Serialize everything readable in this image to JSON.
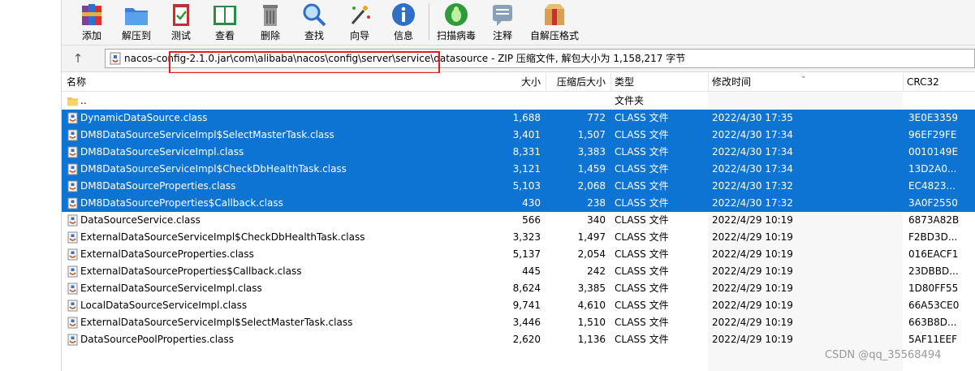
{
  "toolbar": {
    "buttons": [
      {
        "label": "添加",
        "icon": "add-archive-icon"
      },
      {
        "label": "解压到",
        "icon": "extract-to-folder-icon"
      },
      {
        "label": "测试",
        "icon": "test-clipboard-icon"
      },
      {
        "label": "查看",
        "icon": "view-book-icon"
      },
      {
        "label": "删除",
        "icon": "delete-trash-icon"
      },
      {
        "label": "查找",
        "icon": "find-magnifier-icon"
      },
      {
        "label": "向导",
        "icon": "wizard-wand-icon"
      },
      {
        "label": "信息",
        "icon": "info-icon"
      },
      {
        "label": "扫描病毒",
        "icon": "scan-virus-bug-icon"
      },
      {
        "label": "注释",
        "icon": "comment-icon"
      },
      {
        "label": "自解压格式",
        "icon": "sfx-box-icon"
      }
    ]
  },
  "address": {
    "path_prefix": "nacos-config-2.1.0.jar\\",
    "path_highlight": "com\\alibaba\\nacos\\config\\server\\service\\datasource",
    "path_suffix": " - ZIP 压缩文件, 解包大小为 1,158,217 字节"
  },
  "columns": {
    "name": "名称",
    "size": "大小",
    "packed": "压缩后大小",
    "type": "类型",
    "modified": "修改时间",
    "crc": "CRC32"
  },
  "rows": [
    {
      "name": "..",
      "size": "",
      "packed": "",
      "type": "文件夹",
      "modified": "",
      "crc": "",
      "selected": false,
      "kind": "folder"
    },
    {
      "name": "DynamicDataSource.class",
      "size": "1,688",
      "packed": "772",
      "type": "CLASS 文件",
      "modified": "2022/4/30 17:35",
      "crc": "3E0E3359",
      "selected": true,
      "kind": "file"
    },
    {
      "name": "DM8DataSourceServiceImpl$SelectMasterTask.class",
      "size": "3,401",
      "packed": "1,507",
      "type": "CLASS 文件",
      "modified": "2022/4/30 17:34",
      "crc": "96EF29FE",
      "selected": true,
      "kind": "file"
    },
    {
      "name": "DM8DataSourceServiceImpl.class",
      "size": "8,331",
      "packed": "3,383",
      "type": "CLASS 文件",
      "modified": "2022/4/30 17:34",
      "crc": "0010149E",
      "selected": true,
      "kind": "file"
    },
    {
      "name": "DM8DataSourceServiceImpl$CheckDbHealthTask.class",
      "size": "3,121",
      "packed": "1,459",
      "type": "CLASS 文件",
      "modified": "2022/4/30 17:34",
      "crc": "13D2A0...",
      "selected": true,
      "kind": "file"
    },
    {
      "name": "DM8DataSourceProperties.class",
      "size": "5,103",
      "packed": "2,068",
      "type": "CLASS 文件",
      "modified": "2022/4/30 17:32",
      "crc": "EC4823...",
      "selected": true,
      "kind": "file"
    },
    {
      "name": "DM8DataSourceProperties$Callback.class",
      "size": "430",
      "packed": "238",
      "type": "CLASS 文件",
      "modified": "2022/4/30 17:32",
      "crc": "3A0F2550",
      "selected": true,
      "kind": "file"
    },
    {
      "name": "DataSourceService.class",
      "size": "566",
      "packed": "340",
      "type": "CLASS 文件",
      "modified": "2022/4/29 10:19",
      "crc": "6873A82B",
      "selected": false,
      "kind": "file"
    },
    {
      "name": "ExternalDataSourceServiceImpl$CheckDbHealthTask.class",
      "size": "3,323",
      "packed": "1,497",
      "type": "CLASS 文件",
      "modified": "2022/4/29 10:19",
      "crc": "F2BD3D...",
      "selected": false,
      "kind": "file"
    },
    {
      "name": "ExternalDataSourceProperties.class",
      "size": "5,137",
      "packed": "2,054",
      "type": "CLASS 文件",
      "modified": "2022/4/29 10:19",
      "crc": "016EACF1",
      "selected": false,
      "kind": "file"
    },
    {
      "name": "ExternalDataSourceProperties$Callback.class",
      "size": "445",
      "packed": "242",
      "type": "CLASS 文件",
      "modified": "2022/4/29 10:19",
      "crc": "23DBBD...",
      "selected": false,
      "kind": "file"
    },
    {
      "name": "ExternalDataSourceServiceImpl.class",
      "size": "8,624",
      "packed": "3,385",
      "type": "CLASS 文件",
      "modified": "2022/4/29 10:19",
      "crc": "1D80FF55",
      "selected": false,
      "kind": "file"
    },
    {
      "name": "LocalDataSourceServiceImpl.class",
      "size": "9,741",
      "packed": "4,610",
      "type": "CLASS 文件",
      "modified": "2022/4/29 10:19",
      "crc": "66A53CE0",
      "selected": false,
      "kind": "file"
    },
    {
      "name": "ExternalDataSourceServiceImpl$SelectMasterTask.class",
      "size": "3,446",
      "packed": "1,510",
      "type": "CLASS 文件",
      "modified": "2022/4/29 10:19",
      "crc": "663B8D...",
      "selected": false,
      "kind": "file"
    },
    {
      "name": "DataSourcePoolProperties.class",
      "size": "2,620",
      "packed": "1,136",
      "type": "CLASS 文件",
      "modified": "2022/4/29 10:19",
      "crc": "5AF11EEF",
      "selected": false,
      "kind": "file"
    }
  ],
  "watermark": "CSDN @qq_35568494",
  "colors": {
    "selection": "#0d74d4",
    "highlight_box": "#e02020"
  }
}
